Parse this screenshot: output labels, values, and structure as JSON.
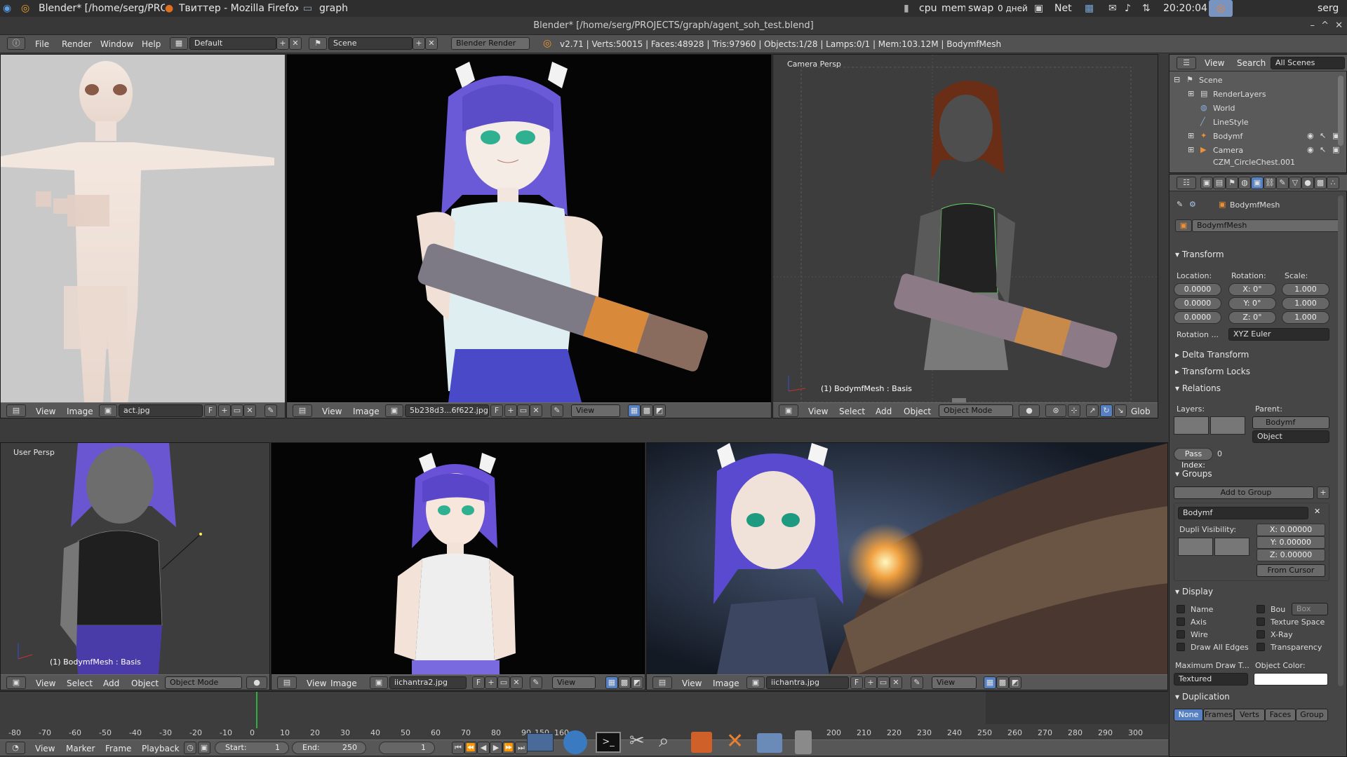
{
  "taskbar": {
    "win1": "Blender* [/home/serg/PROJ...",
    "win2": "Твиттер - Mozilla Firefox",
    "win3": "graph",
    "mon_cpu": "cpu",
    "mon_mem": "mem",
    "mon_swap": "swap",
    "uptime": "0 дней",
    "net": "Net",
    "clock": "20:20:04",
    "user": "serg"
  },
  "window_title": "Blender* [/home/serg/PROJECTS/graph/agent_soh_test.blend]",
  "menu": {
    "file": "File",
    "render": "Render",
    "window": "Window",
    "help": "Help"
  },
  "layout_field": "Default",
  "scene_field": "Scene",
  "engine": "Blender Render",
  "stats": "v2.71 | Verts:50015 | Faces:48928 | Tris:97960 | Objects:1/28 | Lamps:0/1 | Mem:103.12M | BodymfMesh",
  "panes": {
    "p1": {
      "view": "View",
      "image": "Image",
      "file": "act.jpg",
      "f": "F"
    },
    "p2": {
      "view": "View",
      "image": "Image",
      "file": "5b238d3...6f622.jpg",
      "f": "F",
      "view2": "View"
    },
    "p3": {
      "label": "Camera Persp",
      "caption": "(1) BodymfMesh : Basis",
      "view": "View",
      "select": "Select",
      "add": "Add",
      "object": "Object",
      "mode": "Object Mode",
      "glob": "Glob"
    },
    "p4": {
      "label": "User Persp",
      "caption": "(1) BodymfMesh : Basis",
      "view": "View",
      "select": "Select",
      "add": "Add",
      "object": "Object",
      "mode": "Object Mode"
    },
    "p5": {
      "view": "View",
      "image": "Image",
      "file": "iichantra2.jpg",
      "f": "F",
      "view2": "View"
    },
    "p6": {
      "view": "View",
      "image": "Image",
      "file": "iichantra.jpg",
      "f": "F",
      "view2": "View"
    }
  },
  "outliner": {
    "view": "View",
    "search": "Search",
    "filter": "All Scenes",
    "items": [
      "Scene",
      "RenderLayers",
      "World",
      "LineStyle",
      "Bodymf",
      "Camera",
      "CZM_CircleChest.001"
    ]
  },
  "properties": {
    "breadcrumb": "BodymfMesh",
    "object_name": "BodymfMesh",
    "transform": "Transform",
    "location_label": "Location:",
    "rotation_label": "Rotation:",
    "scale_label": "Scale:",
    "loc": [
      "0.0000",
      "0.0000",
      "0.0000"
    ],
    "rot": [
      "X:  0°",
      "Y:  0°",
      "Z:  0°"
    ],
    "scale": [
      "1.000",
      "1.000",
      "1.000"
    ],
    "rotation_mode_label": "Rotation ...",
    "rotation_mode": "XYZ Euler",
    "delta_transform": "Delta Transform",
    "transform_locks": "Transform Locks",
    "relations": "Relations",
    "layers_label": "Layers:",
    "parent_label": "Parent:",
    "parent": "Bodymf",
    "parent_type": "Object",
    "pass_index": "Pass Index:",
    "pass_index_val": "0",
    "groups": "Groups",
    "add_to_group": "Add to Group",
    "group_name": "Bodymf",
    "dupli_visibility": "Dupli Visibility:",
    "dupli": [
      "X:  0.00000",
      "Y:  0.00000",
      "Z:  0.00000"
    ],
    "from_cursor": "From Cursor",
    "display": "Display",
    "disp_left": [
      "Name",
      "Axis",
      "Wire",
      "Draw All Edges"
    ],
    "disp_right": [
      "Bou",
      "Texture Space",
      "X-Ray",
      "Transparency"
    ],
    "bounds_type": "Box",
    "max_draw_label": "Maximum Draw T...",
    "max_draw": "Textured",
    "object_color_label": "Object Color:",
    "duplication": "Duplication",
    "dup_tabs": [
      "None",
      "Frames",
      "Verts",
      "Faces",
      "Group"
    ]
  },
  "timeline": {
    "ruler": [
      "-80",
      "-70",
      "-60",
      "-50",
      "-40",
      "-30",
      "-20",
      "-10",
      "0",
      "10",
      "20",
      "30",
      "40",
      "50",
      "60",
      "70",
      "80",
      "90",
      "150",
      "160",
      "200",
      "210",
      "220",
      "230",
      "240",
      "250",
      "260",
      "270",
      "280",
      "290",
      "300"
    ],
    "view": "View",
    "marker": "Marker",
    "frame": "Frame",
    "playback": "Playback",
    "start": "Start:",
    "start_val": "1",
    "end": "End:",
    "end_val": "250",
    "current": "1"
  },
  "colors": {
    "accent": "#5680c2",
    "panel": "#464646",
    "header": "#575757",
    "viewport": "#3d3d3d"
  }
}
